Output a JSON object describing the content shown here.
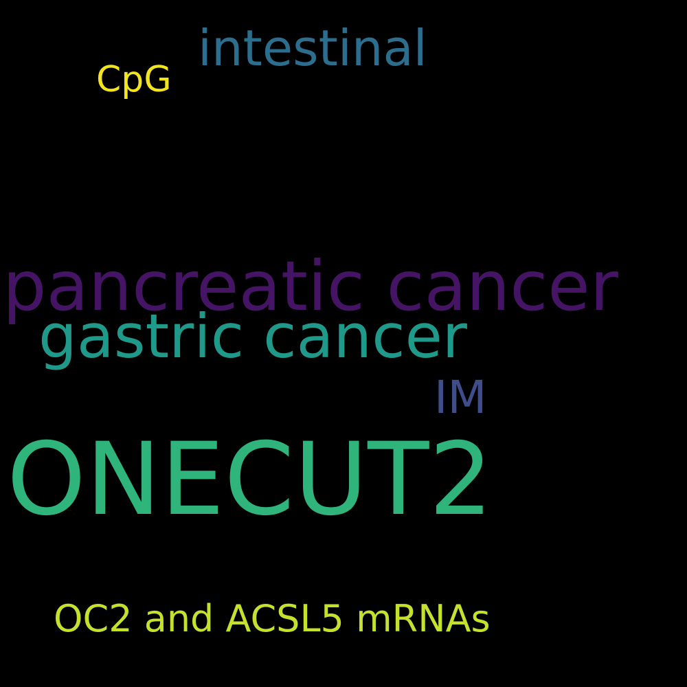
{
  "wordcloud": {
    "background": "#000000",
    "words": [
      {
        "text": "intestinal",
        "color": "#2c6e8e"
      },
      {
        "text": "CpG",
        "color": "#f2e51d"
      },
      {
        "text": "pancreatic cancer",
        "color": "#461464"
      },
      {
        "text": "gastric cancer",
        "color": "#1f9a8a"
      },
      {
        "text": "IM",
        "color": "#3f4e8a"
      },
      {
        "text": "ONECUT2",
        "color": "#2fb47c"
      },
      {
        "text": "OC2 and ACSL5 mRNAs",
        "color": "#c6e02e"
      }
    ]
  }
}
